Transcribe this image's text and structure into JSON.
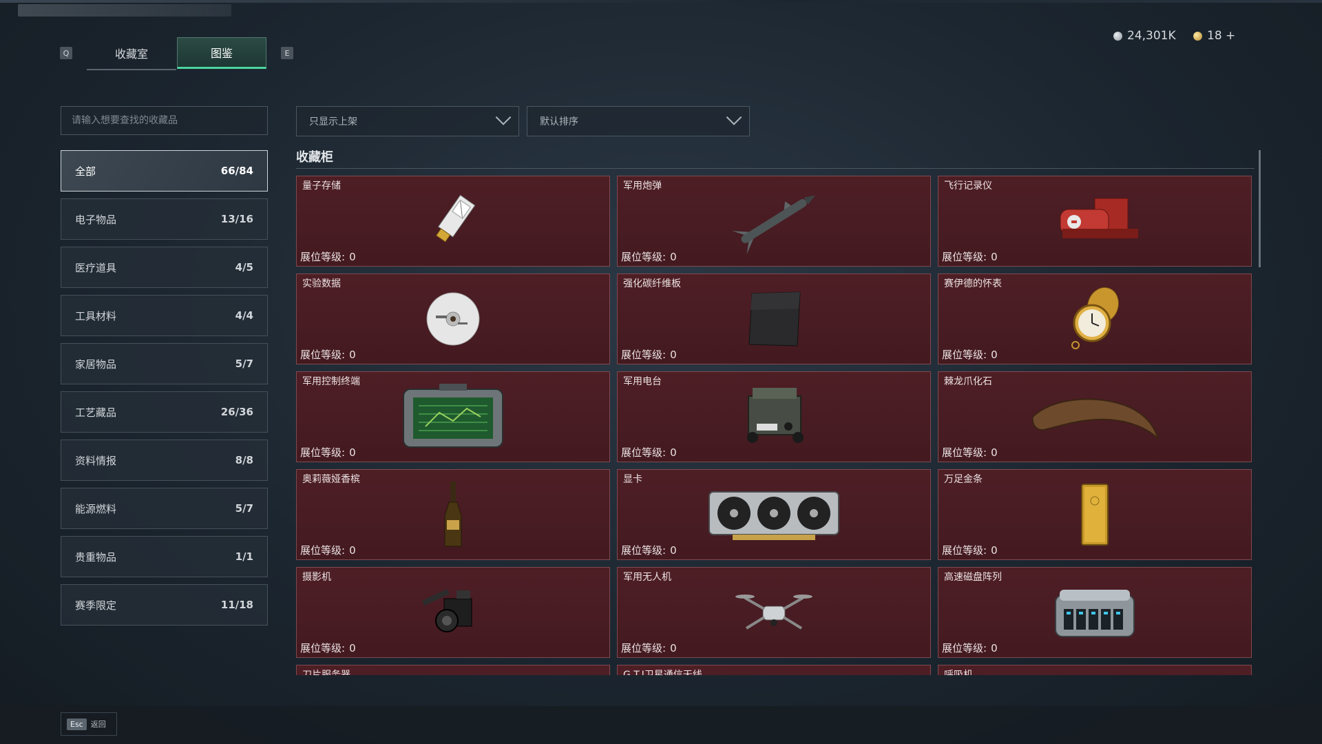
{
  "tabs": {
    "left_key": "Q",
    "right_key": "E",
    "items": [
      {
        "label": "收藏室"
      },
      {
        "label": "图鉴"
      }
    ]
  },
  "currency": {
    "silver": "24,301K",
    "gold": "18 +"
  },
  "search": {
    "placeholder": "请输入想要查找的收藏品"
  },
  "filters": {
    "display": "只显示上架",
    "sort": "默认排序"
  },
  "categories": [
    {
      "label": "全部",
      "count": "66/84"
    },
    {
      "label": "电子物品",
      "count": "13/16"
    },
    {
      "label": "医疗道具",
      "count": "4/5"
    },
    {
      "label": "工具材料",
      "count": "4/4"
    },
    {
      "label": "家居物品",
      "count": "5/7"
    },
    {
      "label": "工艺藏品",
      "count": "26/36"
    },
    {
      "label": "资料情报",
      "count": "8/8"
    },
    {
      "label": "能源燃料",
      "count": "5/7"
    },
    {
      "label": "贵重物品",
      "count": "1/1"
    },
    {
      "label": "赛季限定",
      "count": "11/18"
    }
  ],
  "section_title": "收藏柜",
  "level_label": "展位等级:",
  "items": [
    {
      "name": "量子存储",
      "level": "0",
      "icon": "usb-drive-icon"
    },
    {
      "name": "军用炮弹",
      "level": "0",
      "icon": "missile-icon"
    },
    {
      "name": "飞行记录仪",
      "level": "0",
      "icon": "flight-recorder-icon"
    },
    {
      "name": "实验数据",
      "level": "0",
      "icon": "disc-icon"
    },
    {
      "name": "强化碳纤维板",
      "level": "0",
      "icon": "carbon-plate-icon"
    },
    {
      "name": "赛伊德的怀表",
      "level": "0",
      "icon": "pocket-watch-icon"
    },
    {
      "name": "军用控制终端",
      "level": "0",
      "icon": "control-terminal-icon"
    },
    {
      "name": "军用电台",
      "level": "0",
      "icon": "radio-icon"
    },
    {
      "name": "棘龙爪化石",
      "level": "0",
      "icon": "fossil-claw-icon"
    },
    {
      "name": "奥莉薇娅香槟",
      "level": "0",
      "icon": "champagne-icon"
    },
    {
      "name": "显卡",
      "level": "0",
      "icon": "graphics-card-icon"
    },
    {
      "name": "万足金条",
      "level": "0",
      "icon": "gold-bar-icon"
    },
    {
      "name": "摄影机",
      "level": "0",
      "icon": "camera-icon"
    },
    {
      "name": "军用无人机",
      "level": "0",
      "icon": "drone-icon"
    },
    {
      "name": "高速磁盘阵列",
      "level": "0",
      "icon": "disk-array-icon"
    },
    {
      "name": "刀片服务器",
      "level": "",
      "icon": ""
    },
    {
      "name": "G.T.I卫星通信天线",
      "level": "",
      "icon": ""
    },
    {
      "name": "呼吸机",
      "level": "",
      "icon": ""
    }
  ],
  "footer": {
    "key": "Esc",
    "label": "返回"
  }
}
